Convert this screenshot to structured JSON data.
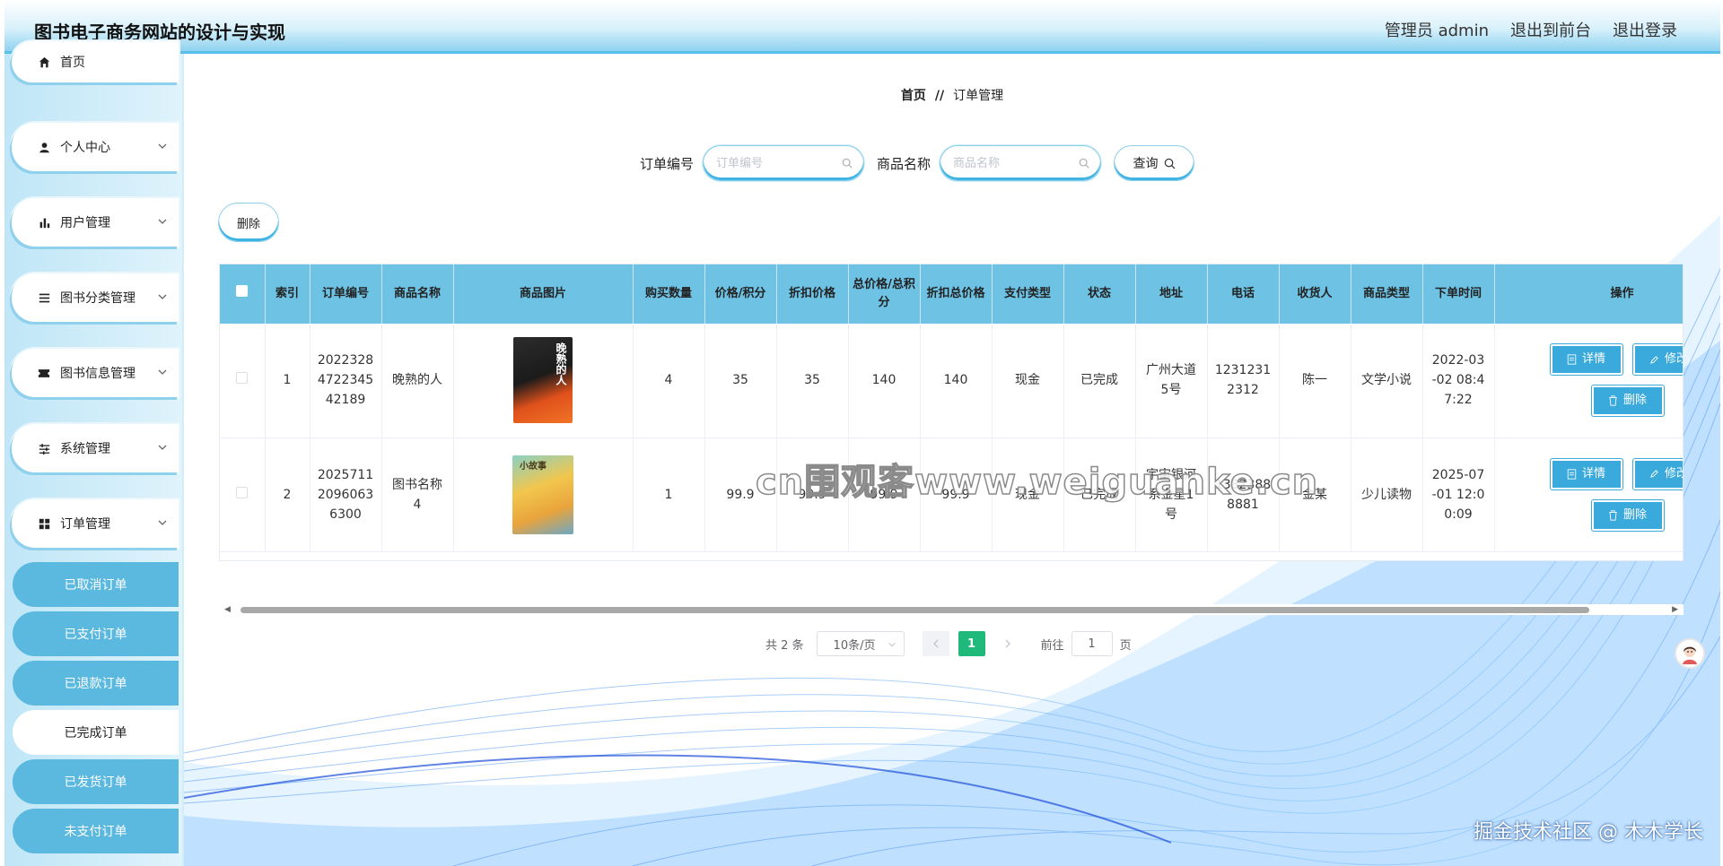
{
  "header": {
    "title": "图书电子商务网站的设计与实现",
    "admin": "管理员 admin",
    "to_front": "退出到前台",
    "logout": "退出登录"
  },
  "sidebar": {
    "items": [
      {
        "label": "首页",
        "icon": "home-icon"
      },
      {
        "label": "个人中心",
        "icon": "user-icon"
      },
      {
        "label": "用户管理",
        "icon": "bar-chart-icon"
      },
      {
        "label": "图书分类管理",
        "icon": "list-icon"
      },
      {
        "label": "图书信息管理",
        "icon": "ticket-icon"
      },
      {
        "label": "系统管理",
        "icon": "sliders-icon"
      },
      {
        "label": "订单管理",
        "icon": "grid-icon"
      }
    ],
    "subitems": [
      "已取消订单",
      "已支付订单",
      "已退款订单",
      "已完成订单",
      "已发货订单",
      "未支付订单"
    ],
    "active_sub": "已完成订单"
  },
  "breadcrumb": {
    "home": "首页",
    "sep": "//",
    "current": "订单管理"
  },
  "search": {
    "order_label": "订单编号",
    "order_placeholder": "订单编号",
    "goods_label": "商品名称",
    "goods_placeholder": "商品名称",
    "query": "查询"
  },
  "actions": {
    "delete": "删除"
  },
  "table": {
    "headers": [
      "索引",
      "订单编号",
      "商品名称",
      "商品图片",
      "购买数量",
      "价格/积分",
      "折扣价格",
      "总价格/总积分",
      "折扣总价格",
      "支付类型",
      "状态",
      "地址",
      "电话",
      "收货人",
      "商品类型",
      "下单时间",
      "操作"
    ],
    "rows": [
      {
        "index": "1",
        "order_no": "2022328472234542189",
        "name": "晚熟的人",
        "qty": "4",
        "price": "35",
        "discount": "35",
        "total": "140",
        "discount_total": "140",
        "pay_type": "现金",
        "status": "已完成",
        "address": "广州大道5号",
        "phone": "12312312312",
        "receiver": "陈一",
        "type": "文学小说",
        "time": "2022-03-02 08:47:22",
        "cover_text": "晚熟的人"
      },
      {
        "index": "2",
        "order_no": "202571120960636300",
        "name": "图书名称4",
        "qty": "1",
        "price": "99.9",
        "discount": "99.9",
        "total": "99.9",
        "discount_total": "99.9",
        "pay_type": "现金",
        "status": "已完成",
        "address": "宇宙银河系金星1号",
        "phone": "13823888881",
        "receiver": "金某",
        "type": "少儿读物",
        "time": "2025-07-01 12:00:09",
        "cover_text": "小故事"
      }
    ],
    "op_detail": "详情",
    "op_edit": "修改",
    "op_delete": "删除"
  },
  "pagination": {
    "total": "共 2 条",
    "page_size": "10条/页",
    "current": "1",
    "goto": "前往",
    "goto_value": "1",
    "page_unit": "页"
  },
  "watermark": "cn围观客www.weiguanke.cn",
  "credit": "掘金技术社区 @ 木木学长",
  "colors": {
    "accent": "#3aa9dc",
    "header_border": "#56c0ea",
    "sub_menu": "#5bb8df",
    "pager_active": "#1fb97c"
  }
}
